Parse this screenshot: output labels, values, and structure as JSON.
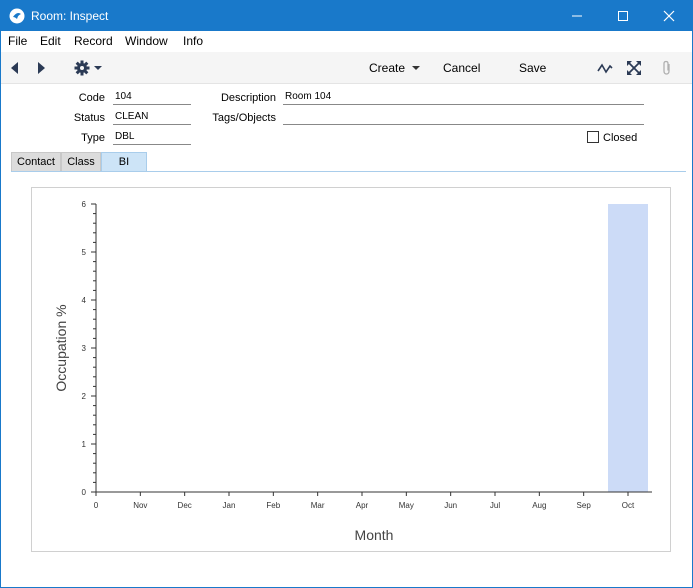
{
  "window": {
    "title": "Room: Inspect"
  },
  "menu": [
    "File",
    "Edit",
    "Record",
    "Window",
    "Info"
  ],
  "toolbar": {
    "create_label": "Create",
    "cancel_label": "Cancel",
    "save_label": "Save"
  },
  "form": {
    "code_label": "Code",
    "code_value": "104",
    "status_label": "Status",
    "status_value": "CLEAN",
    "type_label": "Type",
    "type_value": "DBL",
    "description_label": "Description",
    "description_value": "Room 104",
    "tags_label": "Tags/Objects",
    "tags_value": "",
    "closed_label": "Closed",
    "closed_checked": false
  },
  "tabs": [
    {
      "label": "Contact",
      "active": false
    },
    {
      "label": "Class",
      "active": false
    },
    {
      "label": "BI",
      "active": true
    }
  ],
  "chart_data": {
    "type": "bar",
    "categories": [
      "0",
      "Nov",
      "Dec",
      "Jan",
      "Feb",
      "Mar",
      "Apr",
      "May",
      "Jun",
      "Jul",
      "Aug",
      "Sep",
      "Oct"
    ],
    "values": [
      0,
      0,
      0,
      0,
      0,
      0,
      0,
      0,
      0,
      0,
      0,
      0,
      6
    ],
    "xlabel": "Month",
    "ylabel": "Occupation %",
    "ylim": [
      0,
      6
    ],
    "yticks": [
      0,
      1,
      2,
      3,
      4,
      5,
      6
    ],
    "bar_color": "#ccdbf7",
    "grid": false
  },
  "colors": {
    "titlebar": "#1979ca",
    "active_tab": "#cde4f7"
  }
}
